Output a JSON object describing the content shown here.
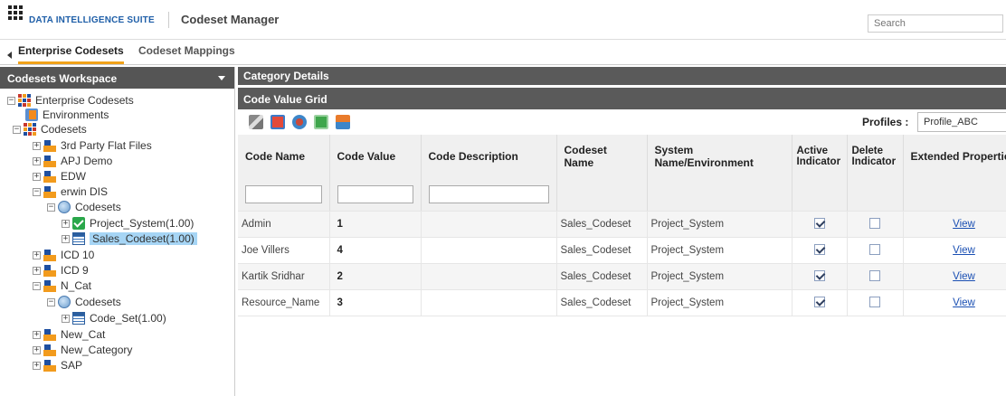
{
  "header": {
    "brand": "DATA INTELLIGENCE SUITE",
    "app_title": "Codeset Manager",
    "search_placeholder": "Search"
  },
  "tabs": [
    {
      "label": "Enterprise Codesets",
      "active": true
    },
    {
      "label": "Codeset Mappings",
      "active": false
    }
  ],
  "workspace": {
    "title": "Codesets Workspace",
    "tree": [
      {
        "label": "Enterprise Codesets",
        "icon": "enterprise-grid-icon"
      },
      {
        "label": "Environments",
        "icon": "environment-icon"
      },
      {
        "label": "Codesets",
        "icon": "codesets-grid-icon"
      },
      {
        "label": "3rd Party Flat Files",
        "icon": "category-folder-icon"
      },
      {
        "label": "APJ Demo",
        "icon": "category-folder-icon"
      },
      {
        "label": "EDW",
        "icon": "category-folder-icon"
      },
      {
        "label": "erwin DIS",
        "icon": "category-folder-icon"
      },
      {
        "label": "Codesets",
        "icon": "codesets-disc-icon"
      },
      {
        "label": "Project_System(1.00)",
        "icon": "check-icon"
      },
      {
        "label": "Sales_Codeset(1.00)",
        "icon": "table-icon",
        "selected": true
      },
      {
        "label": "ICD 10",
        "icon": "category-folder-icon"
      },
      {
        "label": "ICD 9",
        "icon": "category-folder-icon"
      },
      {
        "label": "N_Cat",
        "icon": "category-folder-icon"
      },
      {
        "label": "Codesets",
        "icon": "codesets-disc-icon"
      },
      {
        "label": "Code_Set(1.00)",
        "icon": "table-icon"
      },
      {
        "label": "New_Cat",
        "icon": "category-folder-icon"
      },
      {
        "label": "New_Category",
        "icon": "category-folder-icon"
      },
      {
        "label": "SAP",
        "icon": "category-folder-icon"
      }
    ]
  },
  "category_details_title": "Category Details",
  "grid": {
    "title": "Code Value Grid",
    "profiles_label": "Profiles :",
    "profiles_value": "Profile_ABC",
    "toolbar_icons": [
      "edit-icon",
      "delete-icon",
      "sync-icon",
      "export-icon",
      "import-icon"
    ],
    "columns": [
      "Code Name",
      "Code Value",
      "Code Description",
      "Codeset Name",
      "System Name/Environment",
      "Active Indicator",
      "Delete Indicator",
      "Extended Properties"
    ],
    "rows": [
      {
        "code_name": "Admin",
        "code_value": "1",
        "code_description": "",
        "codeset_name": "Sales_Codeset",
        "system": "Project_System",
        "active": true,
        "delete": false,
        "ext": "View"
      },
      {
        "code_name": "Joe Villers",
        "code_value": "4",
        "code_description": "",
        "codeset_name": "Sales_Codeset",
        "system": "Project_System",
        "active": true,
        "delete": false,
        "ext": "View"
      },
      {
        "code_name": "Kartik Sridhar",
        "code_value": "2",
        "code_description": "",
        "codeset_name": "Sales_Codeset",
        "system": "Project_System",
        "active": true,
        "delete": false,
        "ext": "View"
      },
      {
        "code_name": "Resource_Name",
        "code_value": "3",
        "code_description": "",
        "codeset_name": "Sales_Codeset",
        "system": "Project_System",
        "active": true,
        "delete": false,
        "ext": "View"
      }
    ]
  }
}
